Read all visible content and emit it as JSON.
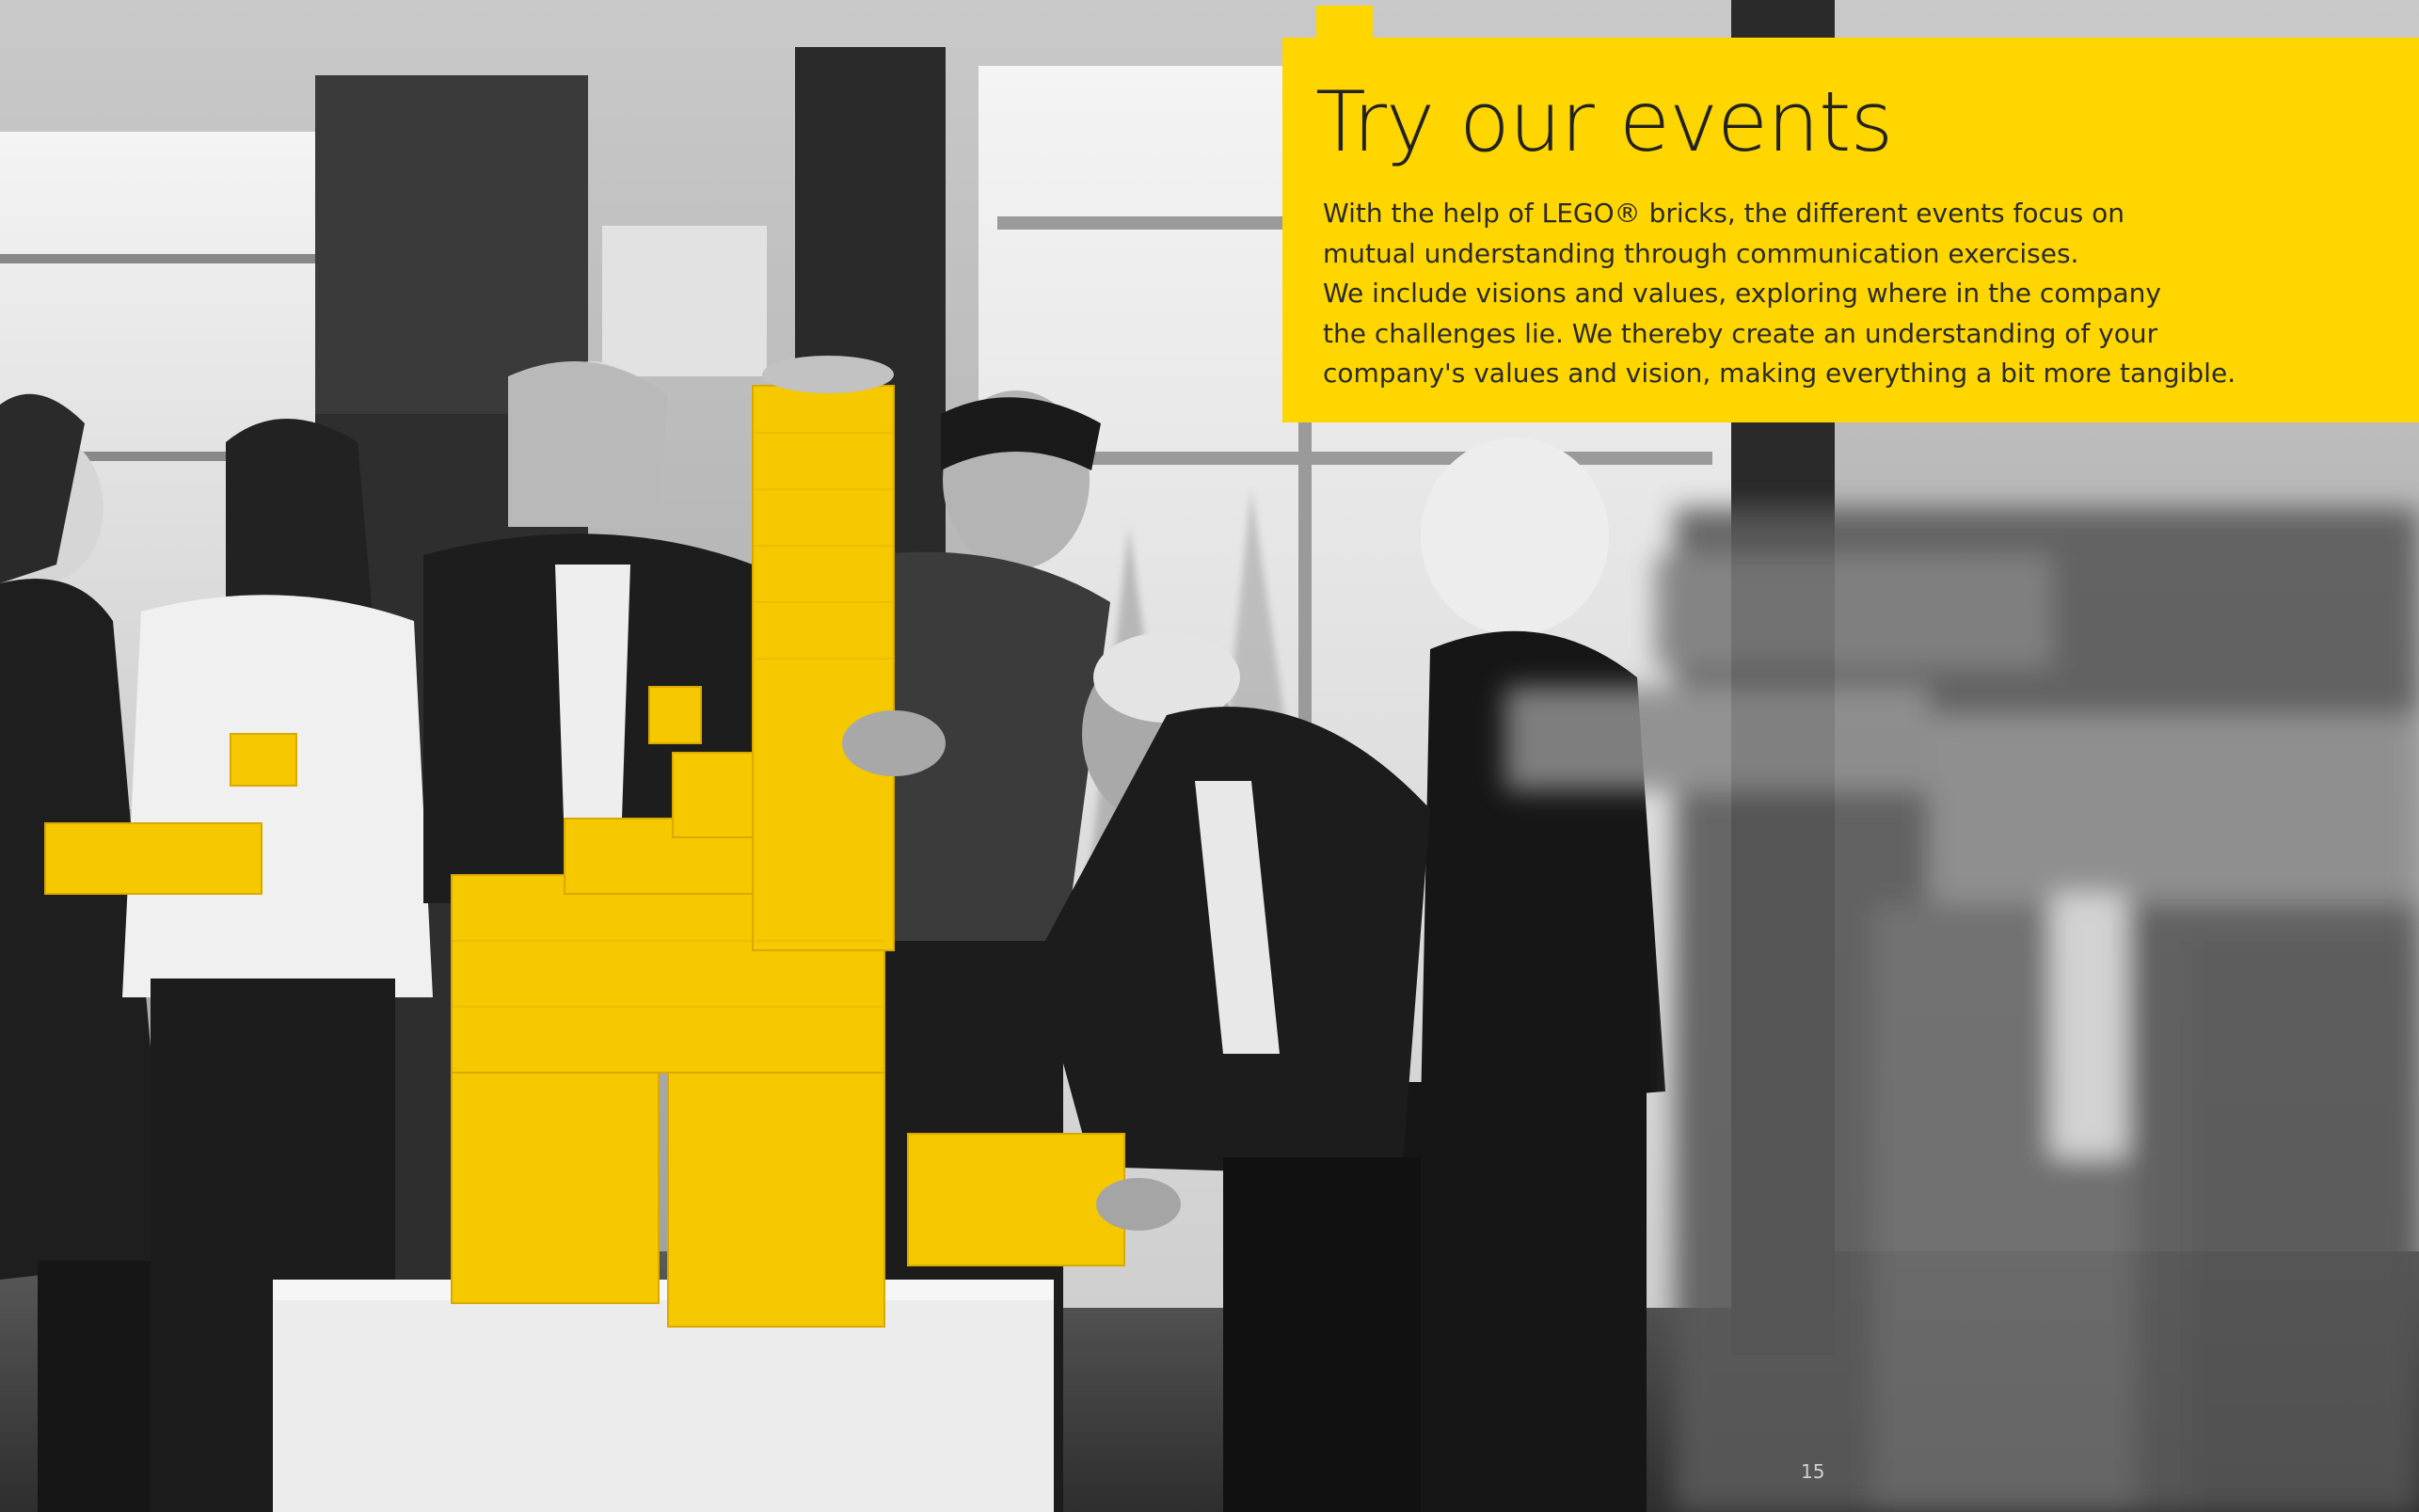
{
  "page": {
    "headline": "Try our events",
    "body_lines": [
      "With the help of LEGO® bricks, the different events focus on",
      "mutual understanding through communication exercises.",
      "We include visions and values, exploring where in the company",
      "the challenges lie. We thereby create an understanding of your",
      "company's values and vision, making everything a bit more tangible."
    ],
    "page_number": "15"
  },
  "colors": {
    "accent_yellow": "#FFD600",
    "brick_yellow": "#F5C800",
    "text_dark": "#222222"
  },
  "photo": {
    "description_icon": "team-building-photo"
  }
}
